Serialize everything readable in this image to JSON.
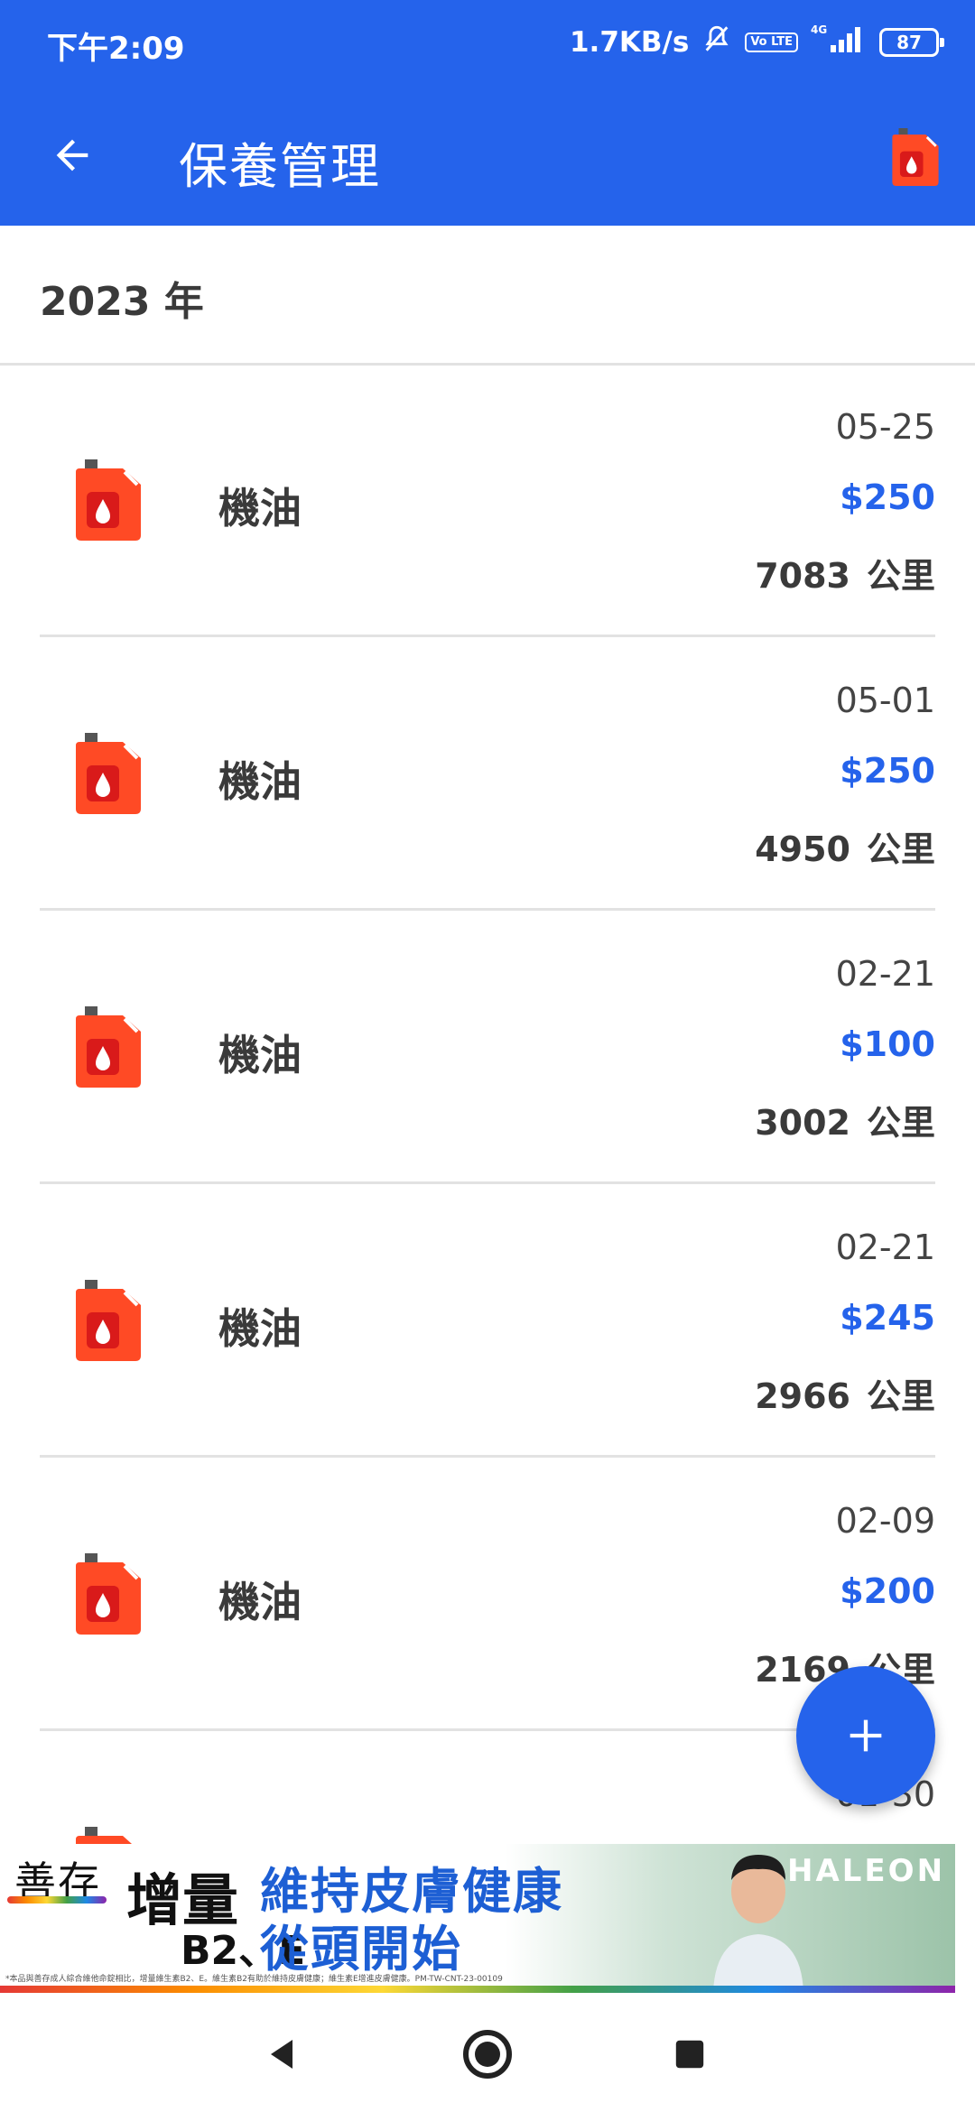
{
  "status_bar": {
    "time": "下午2:09",
    "net_speed": "1.7KB/s",
    "volte": "Vo LTE",
    "network": "4G",
    "battery": "87"
  },
  "toolbar": {
    "title": "保養管理",
    "back_icon": "arrow-left-icon",
    "action_icon": "oil-can-icon"
  },
  "colors": {
    "primary": "#2563eb",
    "oil_icon": "#ff4a25"
  },
  "year_header": "2023 年",
  "records": [
    {
      "name": "機油",
      "date": "05-25",
      "cost": "$250",
      "mileage": "7083",
      "unit": "公里"
    },
    {
      "name": "機油",
      "date": "05-01",
      "cost": "$250",
      "mileage": "4950",
      "unit": "公里"
    },
    {
      "name": "機油",
      "date": "02-21",
      "cost": "$100",
      "mileage": "3002",
      "unit": "公里"
    },
    {
      "name": "機油",
      "date": "02-21",
      "cost": "$245",
      "mileage": "2966",
      "unit": "公里"
    },
    {
      "name": "機油",
      "date": "02-09",
      "cost": "$200",
      "mileage": "2169",
      "unit": "公里"
    },
    {
      "name": "",
      "date": "01-30",
      "cost": "",
      "mileage": "",
      "unit": ""
    }
  ],
  "fab": {
    "icon": "plus-icon"
  },
  "ad": {
    "brand": "善存",
    "product": "增量",
    "product_sub": "B2、E",
    "slogan_line1": "維持皮膚健康",
    "slogan_line2": "從頭開始",
    "logo": "HALEON",
    "fine_print": "*本品與善存成人綜合維他命錠相比，增量維生素B2、E。維生素B2有助於維持皮膚健康；維生素E增進皮膚健康。PM-TW-CNT-23-00109"
  },
  "nav_bar": {
    "back": "nav-back-icon",
    "home": "nav-home-icon",
    "recents": "nav-recents-icon"
  }
}
